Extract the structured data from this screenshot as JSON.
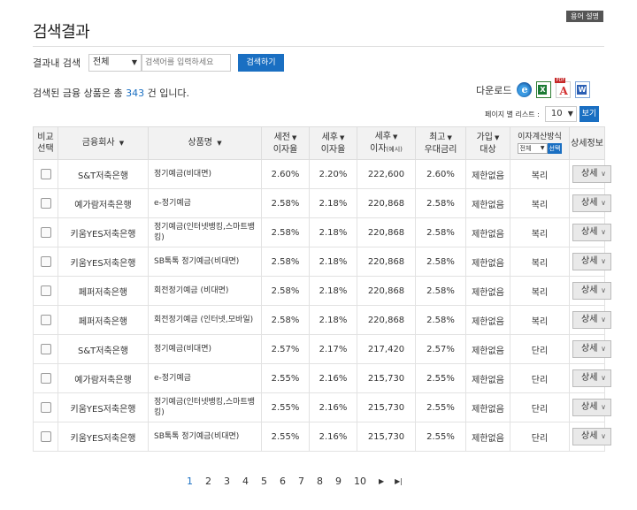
{
  "header": {
    "glossary_button": "용어 설명",
    "title": "검색결과"
  },
  "search": {
    "label": "결과내 검색",
    "scope_value": "전체",
    "placeholder": "검색어를 입력하세요",
    "button": "검색하기"
  },
  "summary": {
    "prefix": "검색된 금융 상품은 총",
    "count": "343",
    "suffix": "건 입니다."
  },
  "download": {
    "label": "다운로드",
    "icons": [
      "ie-icon",
      "excel-icon",
      "pdf-icon",
      "word-icon"
    ]
  },
  "per_page": {
    "label": "페이지 별 리스트 :",
    "value": "10",
    "button": "보기"
  },
  "table": {
    "headers": {
      "compare_1": "비교",
      "compare_2": "선택",
      "company": "금융회사",
      "product": "상품명",
      "pre_tax_1": "세전",
      "pre_tax_2": "이자율",
      "after_tax_1": "세후",
      "after_tax_2": "이자율",
      "after_tax_interest_1": "세후",
      "after_tax_interest_2": "이자",
      "after_tax_interest_note": "(예시)",
      "max_1": "최고",
      "max_2": "우대금리",
      "join_1": "가입",
      "join_2": "대상",
      "calc_title": "이자계산방식",
      "calc_select": "전체",
      "calc_button": "선택",
      "detail": "상세정보"
    },
    "detail_button": "상세",
    "rows": [
      {
        "company": "S&T저축은행",
        "product": "정기예금(비대면)",
        "pre": "2.60%",
        "after": "2.20%",
        "interest": "222,600",
        "max": "2.60%",
        "target": "제한없음",
        "calc": "복리"
      },
      {
        "company": "예가람저축은행",
        "product": "e-정기예금",
        "pre": "2.58%",
        "after": "2.18%",
        "interest": "220,868",
        "max": "2.58%",
        "target": "제한없음",
        "calc": "복리"
      },
      {
        "company": "키움YES저축은행",
        "product": "정기예금(인터넷뱅킹,스마트뱅킹)",
        "pre": "2.58%",
        "after": "2.18%",
        "interest": "220,868",
        "max": "2.58%",
        "target": "제한없음",
        "calc": "복리"
      },
      {
        "company": "키움YES저축은행",
        "product": "SB톡톡 정기예금(비대면)",
        "pre": "2.58%",
        "after": "2.18%",
        "interest": "220,868",
        "max": "2.58%",
        "target": "제한없음",
        "calc": "복리"
      },
      {
        "company": "페퍼저축은행",
        "product": "회전정기예금 (비대면)",
        "pre": "2.58%",
        "after": "2.18%",
        "interest": "220,868",
        "max": "2.58%",
        "target": "제한없음",
        "calc": "복리"
      },
      {
        "company": "페퍼저축은행",
        "product": "회전정기예금 (인터넷,모바일)",
        "pre": "2.58%",
        "after": "2.18%",
        "interest": "220,868",
        "max": "2.58%",
        "target": "제한없음",
        "calc": "복리"
      },
      {
        "company": "S&T저축은행",
        "product": "정기예금(비대면)",
        "pre": "2.57%",
        "after": "2.17%",
        "interest": "217,420",
        "max": "2.57%",
        "target": "제한없음",
        "calc": "단리"
      },
      {
        "company": "예가람저축은행",
        "product": "e-정기예금",
        "pre": "2.55%",
        "after": "2.16%",
        "interest": "215,730",
        "max": "2.55%",
        "target": "제한없음",
        "calc": "단리"
      },
      {
        "company": "키움YES저축은행",
        "product": "정기예금(인터넷뱅킹,스마트뱅킹)",
        "pre": "2.55%",
        "after": "2.16%",
        "interest": "215,730",
        "max": "2.55%",
        "target": "제한없음",
        "calc": "단리"
      },
      {
        "company": "키움YES저축은행",
        "product": "SB톡톡 정기예금(비대면)",
        "pre": "2.55%",
        "after": "2.16%",
        "interest": "215,730",
        "max": "2.55%",
        "target": "제한없음",
        "calc": "단리"
      }
    ]
  },
  "pagination": {
    "pages": [
      "1",
      "2",
      "3",
      "4",
      "5",
      "6",
      "7",
      "8",
      "9",
      "10"
    ],
    "current": "1",
    "next": "▶",
    "last": "▶|"
  },
  "colors": {
    "accent": "#1a6fc2",
    "header_bg": "#f2f2f2"
  }
}
